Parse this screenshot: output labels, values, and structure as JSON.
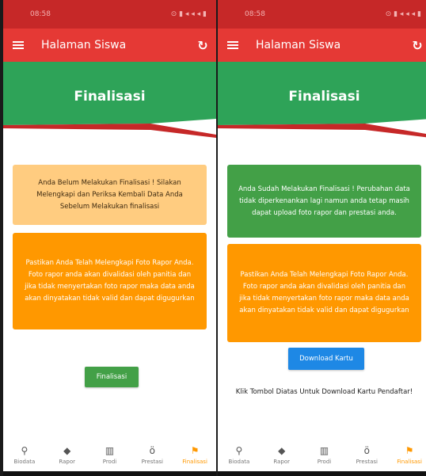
{
  "left": {
    "status_time": "08:58",
    "status_icons": "⊙ ▮ ◂ ◂ ◂ ▮",
    "appbar_title": "Halaman Siswa",
    "banner_title": "Finalisasi",
    "info_card": "Anda Belum Melakukan Finalisasi ! Silakan Melengkapi dan Periksa Kembali Data Anda Sebelum Melakukan finalisasi",
    "warning_card": "Pastikan Anda Telah Melengkapi Foto Rapor Anda. Foto rapor anda akan divalidasi oleh panitia dan jika tidak menyertakan foto rapor maka data anda akan dinyatakan tidak valid dan dapat digugurkan",
    "button_label": "Finalisasi"
  },
  "right": {
    "status_time": "08:58",
    "status_icons": "⊙ ▮ ◂ ◂ ◂ ▮",
    "appbar_title": "Halaman Siswa",
    "banner_title": "Finalisasi",
    "info_card": "Anda Sudah Melakukan Finalisasi ! Perubahan data tidak diperkenankan lagi namun anda tetap masih dapat upload foto rapor dan prestasi anda.",
    "warning_card": "Pastikan Anda Telah Melengkapi Foto Rapor Anda. Foto rapor anda akan divalidasi oleh panitia dan jika tidak menyertakan foto rapor maka data anda akan dinyatakan tidak valid dan dapat digugurkan",
    "button_label": "Download Kartu",
    "note": "Klik Tombol Diatas Untuk Download Kartu Pendaftar!"
  },
  "nav": [
    {
      "label": "Biodata",
      "icon": "person-icon"
    },
    {
      "label": "Rapor",
      "icon": "graduation-cap-icon"
    },
    {
      "label": "Prodi",
      "icon": "building-icon"
    },
    {
      "label": "Prestasi",
      "icon": "medal-icon"
    },
    {
      "label": "Finalisasi",
      "icon": "flag-icon"
    }
  ],
  "colors": {
    "appbar": "#e53935",
    "banner": "#2ea358",
    "accent": "#ff9800",
    "success": "#43a047",
    "button_blue": "#1e88e5"
  }
}
